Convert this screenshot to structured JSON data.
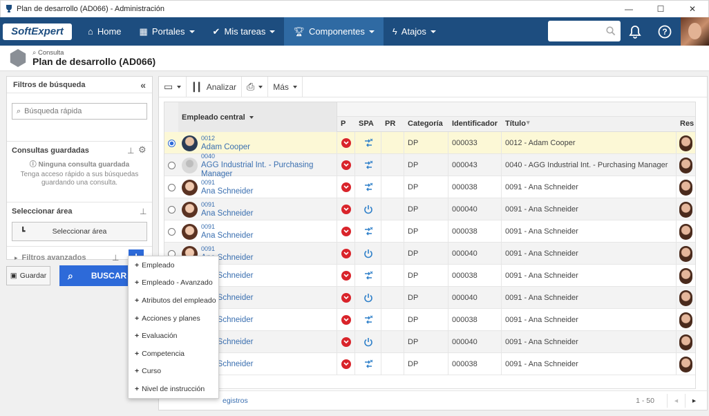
{
  "window": {
    "title": "Plan de desarrollo (AD066) - Administración"
  },
  "nav": {
    "logo": "SoftExpert",
    "items": [
      {
        "label": "Home",
        "icon": "home-icon",
        "dropdown": false
      },
      {
        "label": "Portales",
        "icon": "grid-icon",
        "dropdown": true
      },
      {
        "label": "Mis tareas",
        "icon": "check-icon",
        "dropdown": true
      },
      {
        "label": "Componentes",
        "icon": "trophy-icon",
        "dropdown": true,
        "active": true
      },
      {
        "label": "Atajos",
        "icon": "bolt-icon",
        "dropdown": true
      }
    ]
  },
  "header": {
    "breadcrumb": "Consulta",
    "title": "Plan de desarrollo (AD066)"
  },
  "filters": {
    "title": "Filtros de búsqueda",
    "quick_search_placeholder": "Búsqueda rápida",
    "saved_title": "Consultas guardadas",
    "saved_empty": "Ninguna consulta guardada",
    "saved_hint": "Tenga acceso rápido a sus búsquedas guardando una consulta.",
    "area_title": "Seleccionar área",
    "area_button": "Seleccionar área",
    "advanced": "Filtros avanzados",
    "save_button": "Guardar",
    "search_button": "BUSCAR"
  },
  "toolbar": {
    "analyze": "Analizar",
    "more": "Más"
  },
  "grid": {
    "columns": [
      "Empleado central",
      "P",
      "SPA",
      "PR",
      "Categoría",
      "Identificador",
      "Título",
      "Res"
    ],
    "rows": [
      {
        "code": "0012",
        "name": "Adam Cooper",
        "spa": "transfer",
        "cat": "DP",
        "id": "000033",
        "title": "0012 - Adam Cooper",
        "selected": true,
        "avatar": "man"
      },
      {
        "code": "0040",
        "name": "AGG Industrial Int. - Purchasing Manager",
        "spa": "transfer",
        "cat": "DP",
        "id": "000043",
        "title": "0040 - AGG Industrial Int. - Purchasing Manager",
        "selected": false,
        "avatar": "generic"
      },
      {
        "code": "0091",
        "name": "Ana Schneider",
        "spa": "transfer",
        "cat": "DP",
        "id": "000038",
        "title": "0091 - Ana Schneider",
        "selected": false,
        "avatar": "woman"
      },
      {
        "code": "0091",
        "name": "Ana Schneider",
        "spa": "power",
        "cat": "DP",
        "id": "000040",
        "title": "0091 - Ana Schneider",
        "selected": false,
        "avatar": "woman"
      },
      {
        "code": "0091",
        "name": "Ana Schneider",
        "spa": "transfer",
        "cat": "DP",
        "id": "000038",
        "title": "0091 - Ana Schneider",
        "selected": false,
        "avatar": "woman"
      },
      {
        "code": "0091",
        "name": "Ana Schneider",
        "spa": "power",
        "cat": "DP",
        "id": "000040",
        "title": "0091 - Ana Schneider",
        "selected": false,
        "avatar": "woman"
      },
      {
        "code": "",
        "name": "Ana Schneider",
        "spa": "transfer",
        "cat": "DP",
        "id": "000038",
        "title": "0091 - Ana Schneider",
        "selected": false,
        "avatar": "woman"
      },
      {
        "code": "",
        "name": "Ana Schneider",
        "spa": "power",
        "cat": "DP",
        "id": "000040",
        "title": "0091 - Ana Schneider",
        "selected": false,
        "avatar": "woman"
      },
      {
        "code": "",
        "name": "Ana Schneider",
        "spa": "transfer",
        "cat": "DP",
        "id": "000038",
        "title": "0091 - Ana Schneider",
        "selected": false,
        "avatar": "woman"
      },
      {
        "code": "",
        "name": "Ana Schneider",
        "spa": "power",
        "cat": "DP",
        "id": "000040",
        "title": "0091 - Ana Schneider",
        "selected": false,
        "avatar": "woman"
      },
      {
        "code": "",
        "name": "Ana Schneider",
        "spa": "transfer",
        "cat": "DP",
        "id": "000038",
        "title": "0091 - Ana Schneider",
        "selected": false,
        "avatar": "woman"
      }
    ]
  },
  "footer": {
    "records": "egistros",
    "range": "1 - 50"
  },
  "menu": {
    "items": [
      "Empleado",
      "Empleado - Avanzado",
      "Atributos del empleado",
      "Acciones y planes",
      "Evaluación",
      "Competencia",
      "Curso",
      "Nivel de instrucción"
    ]
  },
  "colors": {
    "nav": "#1d4d7f",
    "accent": "#2d6ad9",
    "priority": "#d9242b",
    "link": "#3a6fb0"
  }
}
